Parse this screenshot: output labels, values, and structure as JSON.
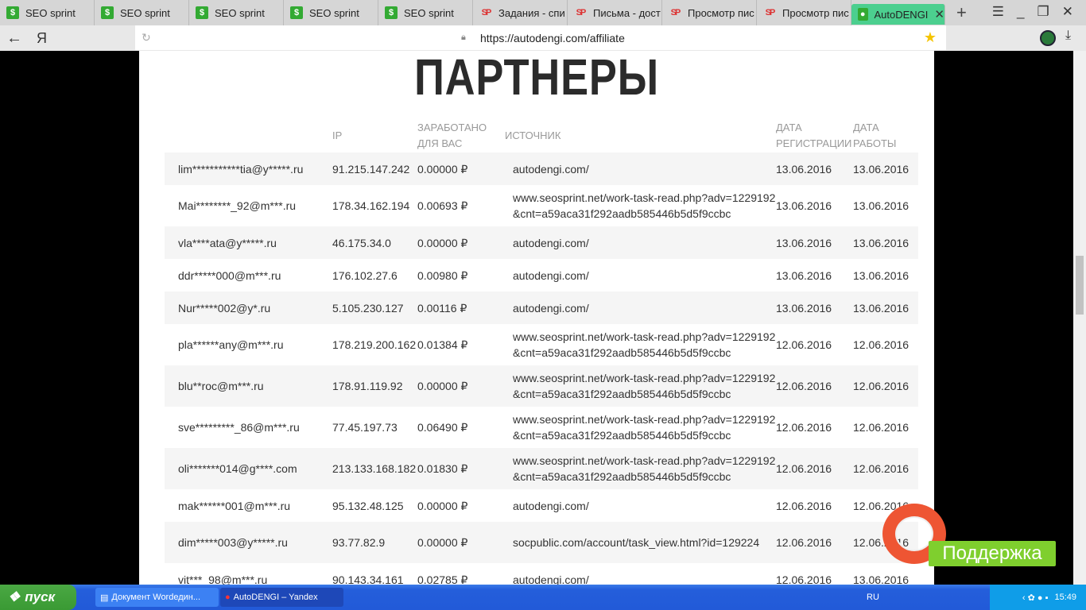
{
  "browser": {
    "tabs": [
      {
        "label": "SEO sprint",
        "icon": "seosprint-icon"
      },
      {
        "label": "SEO sprint",
        "icon": "seosprint-icon"
      },
      {
        "label": "SEO sprint",
        "icon": "seosprint-icon"
      },
      {
        "label": "SEO sprint",
        "icon": "seosprint-icon"
      },
      {
        "label": "SEO sprint",
        "icon": "seosprint-icon"
      },
      {
        "label": "Задания - спи",
        "icon": "sp-icon"
      },
      {
        "label": "Письма - дост",
        "icon": "sp-icon"
      },
      {
        "label": "Просмотр пис",
        "icon": "sp-icon"
      },
      {
        "label": "Просмотр пис",
        "icon": "sp-icon"
      }
    ],
    "active_tab": "AutoDENGI",
    "url": "https://autodengi.com/affiliate",
    "yandex_logo": "Я"
  },
  "page": {
    "title": "ПАРТНЕРЫ",
    "headers": {
      "email": "",
      "ip": "IP",
      "earned": "ЗАРАБОТАНО ДЛЯ ВАС",
      "source": "ИСТОЧНИК",
      "reg_date": "ДАТА РЕГИСТРАЦИИ",
      "work_date": "ДАТА РАБОТЫ"
    },
    "rows": [
      {
        "email": "lim***********tia@y*****.ru",
        "ip": "91.215.147.242",
        "earned": "0.00000 ₽",
        "source": "autodengi.com/",
        "reg": "13.06.2016",
        "work": "13.06.2016"
      },
      {
        "email": "Mai********_92@m***.ru",
        "ip": "178.34.162.194",
        "earned": "0.00693 ₽",
        "source": "www.seosprint.net/work-task-read.php?adv=1229192&cnt=a59aca31f292aadb585446b5d5f9ccbc",
        "reg": "13.06.2016",
        "work": "13.06.2016"
      },
      {
        "email": "vla****ata@y*****.ru",
        "ip": "46.175.34.0",
        "earned": "0.00000 ₽",
        "source": "autodengi.com/",
        "reg": "13.06.2016",
        "work": "13.06.2016"
      },
      {
        "email": "ddr*****000@m***.ru",
        "ip": "176.102.27.6",
        "earned": "0.00980 ₽",
        "source": "autodengi.com/",
        "reg": "13.06.2016",
        "work": "13.06.2016"
      },
      {
        "email": "Nur*****002@y*.ru",
        "ip": "5.105.230.127",
        "earned": "0.00116 ₽",
        "source": "autodengi.com/",
        "reg": "13.06.2016",
        "work": "13.06.2016"
      },
      {
        "email": "pla******any@m***.ru",
        "ip": "178.219.200.162",
        "earned": "0.01384 ₽",
        "source": "www.seosprint.net/work-task-read.php?adv=1229192&cnt=a59aca31f292aadb585446b5d5f9ccbc",
        "reg": "12.06.2016",
        "work": "12.06.2016"
      },
      {
        "email": "blu**roc@m***.ru",
        "ip": "178.91.119.92",
        "earned": "0.00000 ₽",
        "source": "www.seosprint.net/work-task-read.php?adv=1229192&cnt=a59aca31f292aadb585446b5d5f9ccbc",
        "reg": "12.06.2016",
        "work": "12.06.2016"
      },
      {
        "email": "sve*********_86@m***.ru",
        "ip": "77.45.197.73",
        "earned": "0.06490 ₽",
        "source": "www.seosprint.net/work-task-read.php?adv=1229192&cnt=a59aca31f292aadb585446b5d5f9ccbc",
        "reg": "12.06.2016",
        "work": "12.06.2016"
      },
      {
        "email": "oli*******014@g****.com",
        "ip": "213.133.168.182",
        "earned": "0.01830 ₽",
        "source": "www.seosprint.net/work-task-read.php?adv=1229192&cnt=a59aca31f292aadb585446b5d5f9ccbc",
        "reg": "12.06.2016",
        "work": "12.06.2016"
      },
      {
        "email": "mak******001@m***.ru",
        "ip": "95.132.48.125",
        "earned": "0.00000 ₽",
        "source": "autodengi.com/",
        "reg": "12.06.2016",
        "work": "12.06.2016"
      },
      {
        "email": "dim*****003@y*****.ru",
        "ip": "93.77.82.9",
        "earned": "0.00000 ₽",
        "source": "socpublic.com/account/task_view.html?id=129224",
        "reg": "12.06.2016",
        "work": "12.06.2016"
      },
      {
        "email": "vit***_98@m***.ru",
        "ip": "90.143.34.161",
        "earned": "0.02785 ₽",
        "source": "autodengi.com/",
        "reg": "12.06.2016",
        "work": "13.06.2016"
      }
    ],
    "support_label": "Поддержка"
  },
  "taskbar": {
    "start": "пуск",
    "tasks": [
      "Документ Wordедин...",
      "AutoDENGI – Yandex"
    ],
    "lang": "RU",
    "clock": "15:49"
  }
}
